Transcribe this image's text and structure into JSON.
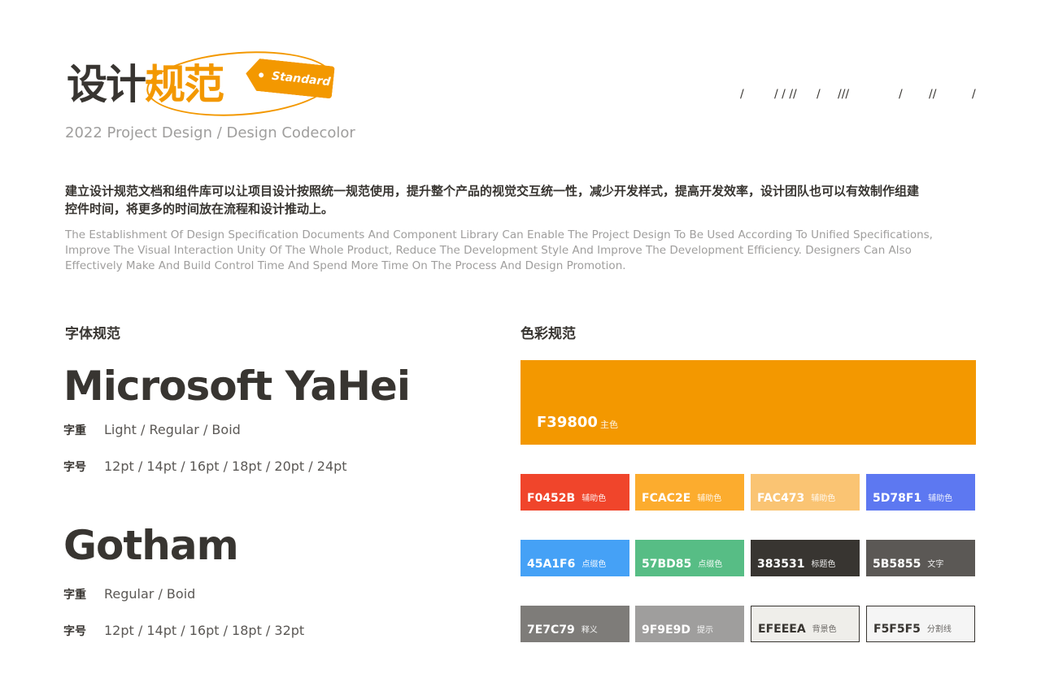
{
  "header": {
    "title_part1": "设计",
    "title_part2": "规范",
    "tag": "Standard",
    "subtitle": "2022 Project Design / Design Codecolor",
    "slashes": [
      "/",
      "/ / //",
      "/",
      "///",
      "/",
      "//",
      "/"
    ]
  },
  "intro": {
    "cn": "建立设计规范文档和组件库可以让项目设计按照统一规范使用，提升整个产品的视觉交互统一性，减少开发样式，提高开发效率，设计团队也可以有效制作组建控件时间，将更多的时间放在流程和设计推动上。",
    "en": "The Establishment Of Design Specification Documents And Component Library Can Enable The Project Design To Be Used According To Unified Specifications, Improve The Visual Interaction Unity Of The Whole Product, Reduce The Development Style And Improve The Development Efficiency. Designers Can Also Effectively Make And Build Control Time And Spend More Time On The Process And Design Promotion."
  },
  "fonts": {
    "section_title": "字体规范",
    "items": [
      {
        "name": "Microsoft YaHei",
        "weight_label": "字重",
        "weights": "Light / Regular / Boid",
        "size_label": "字号",
        "sizes": "12pt / 14pt / 16pt / 18pt / 20pt / 24pt"
      },
      {
        "name": "Gotham",
        "weight_label": "字重",
        "weights": "Regular / Boid",
        "size_label": "字号",
        "sizes": "12pt / 14pt / 16pt / 18pt  / 32pt"
      }
    ]
  },
  "colors": {
    "section_title": "色彩规范",
    "main": {
      "hex": "F39800",
      "role": "主色",
      "color": "#F39800"
    },
    "swatches": [
      {
        "hex": "F0452B",
        "role": "辅助色",
        "color": "#F0452B"
      },
      {
        "hex": "FCAC2E",
        "role": "辅助色",
        "color": "#FCAC2E"
      },
      {
        "hex": "FAC473",
        "role": "辅助色",
        "color": "#FAC473"
      },
      {
        "hex": "5D78F1",
        "role": "辅助色",
        "color": "#5D78F1"
      },
      {
        "hex": "45A1F6",
        "role": "点缀色",
        "color": "#45A1F6"
      },
      {
        "hex": "57BD85",
        "role": "点缀色",
        "color": "#57BD85"
      },
      {
        "hex": "383531",
        "role": "标题色",
        "color": "#383531"
      },
      {
        "hex": "5B5855",
        "role": "文字",
        "color": "#5B5855"
      },
      {
        "hex": "7E7C79",
        "role": "释义",
        "color": "#7E7C79"
      },
      {
        "hex": "9F9E9D",
        "role": "提示",
        "color": "#9F9E9D"
      },
      {
        "hex": "EFEEEA",
        "role": "背景色",
        "color": "#EFEEEA"
      },
      {
        "hex": "F5F5F5",
        "role": "分割线",
        "color": "#F5F5F5"
      }
    ]
  }
}
